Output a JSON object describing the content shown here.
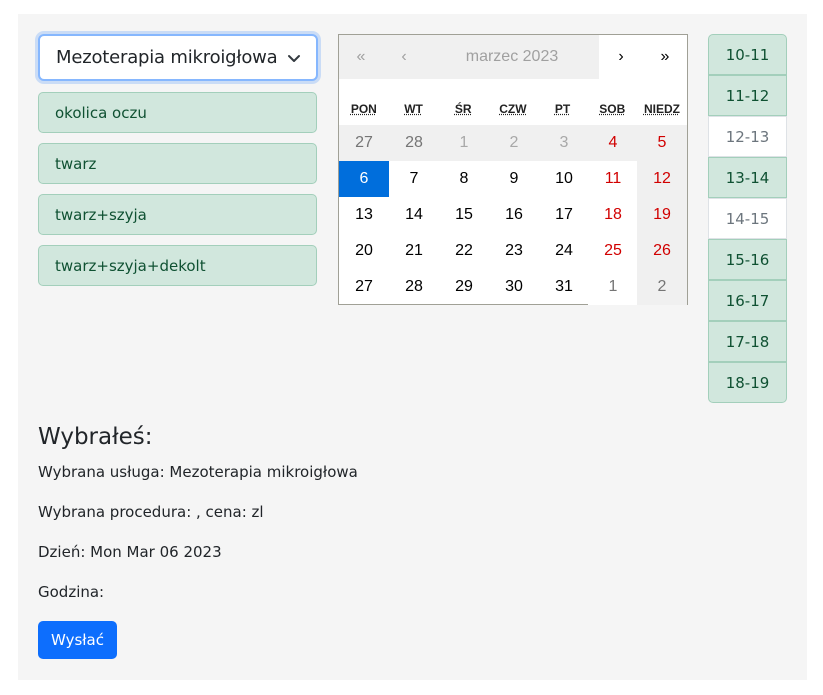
{
  "service_select": {
    "value": "Mezoterapia mikroigłowa",
    "icon": "chevron-down-icon"
  },
  "procedures": [
    "okolica oczu",
    "twarz",
    "twarz+szyja",
    "twarz+szyja+dekolt"
  ],
  "calendar": {
    "nav": {
      "prev2": "«",
      "prev": "‹",
      "label": "marzec 2023",
      "next": "›",
      "next2": "»"
    },
    "weekdays": [
      "PON",
      "WT",
      "ŚR",
      "CZW",
      "PT",
      "SOB",
      "NIEDZ"
    ],
    "weeks": [
      [
        "27",
        "28",
        "1",
        "2",
        "3",
        "4",
        "5"
      ],
      [
        "6",
        "7",
        "8",
        "9",
        "10",
        "11",
        "12"
      ],
      [
        "13",
        "14",
        "15",
        "16",
        "17",
        "18",
        "19"
      ],
      [
        "20",
        "21",
        "22",
        "23",
        "24",
        "25",
        "26"
      ],
      [
        "27",
        "28",
        "29",
        "30",
        "31",
        "1",
        "2"
      ]
    ],
    "selected_day": "6"
  },
  "hours": [
    {
      "label": "10-11",
      "available": true
    },
    {
      "label": "11-12",
      "available": true
    },
    {
      "label": "12-13",
      "available": false
    },
    {
      "label": "13-14",
      "available": true
    },
    {
      "label": "14-15",
      "available": false
    },
    {
      "label": "15-16",
      "available": true
    },
    {
      "label": "16-17",
      "available": true
    },
    {
      "label": "17-18",
      "available": true
    },
    {
      "label": "18-19",
      "available": true
    }
  ],
  "summary": {
    "title": "Wybrałeś:",
    "service": "Wybrana usługa: Mezoterapia mikroigłowa",
    "procedure": "Wybrana procedura: , cena: zl",
    "day": "Dzień: Mon Mar 06 2023",
    "hour": "Godzina:"
  },
  "submit_label": "Wysłać",
  "colors": {
    "accent": "#0d6efd",
    "selected_day": "#006edc",
    "success_bg": "#d1e7dd",
    "weekend": "#d10000"
  }
}
